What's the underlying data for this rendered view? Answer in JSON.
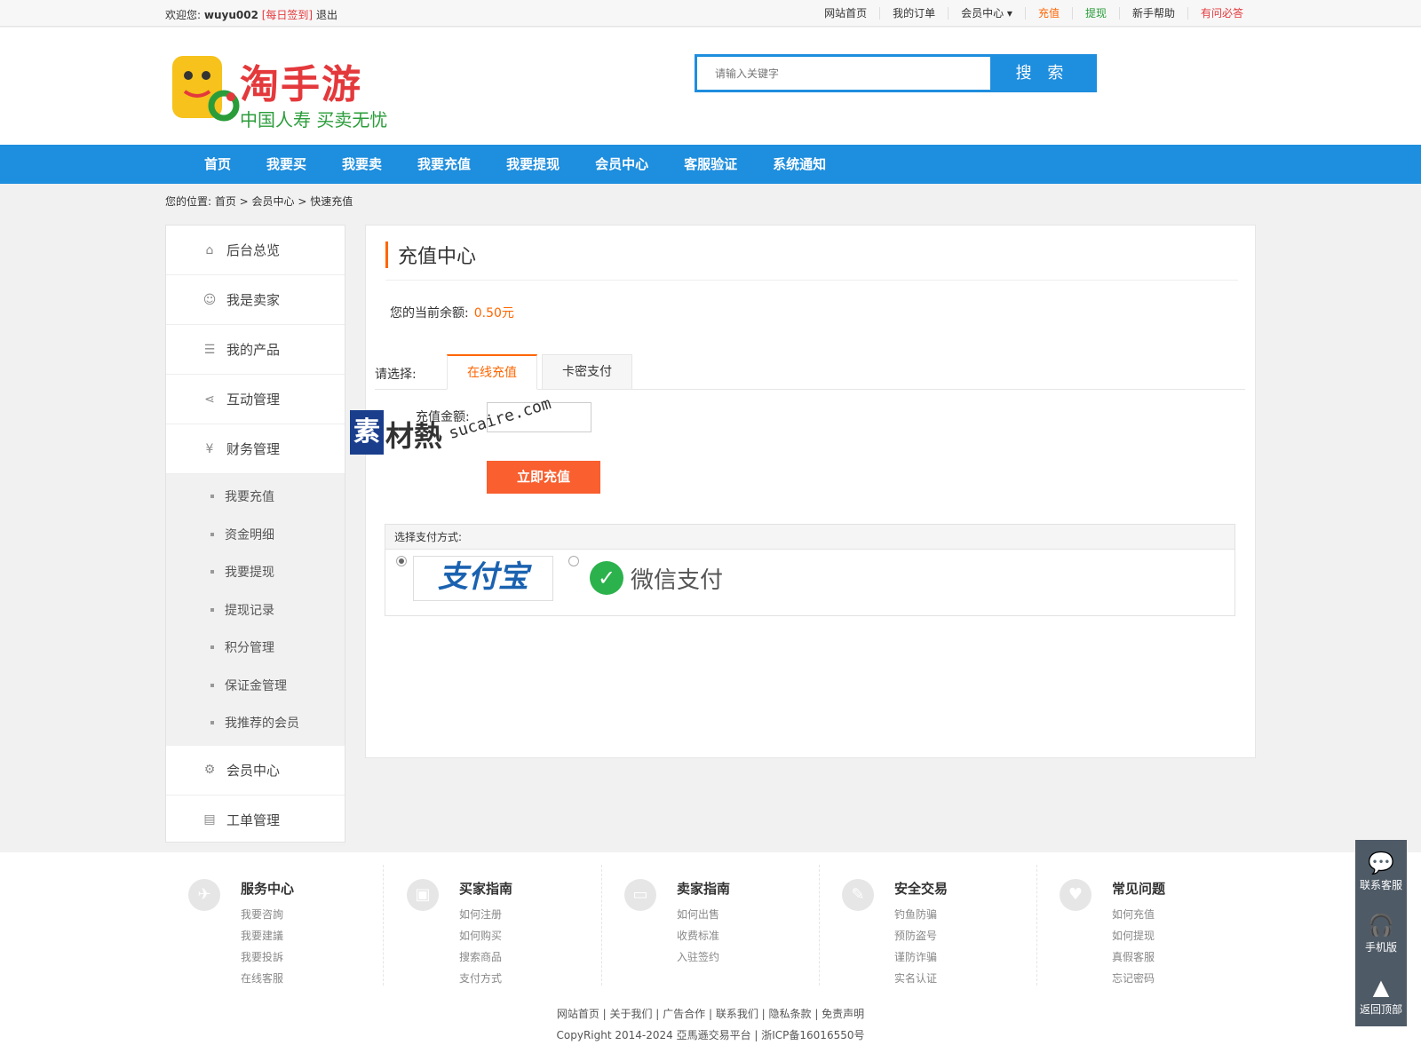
{
  "topbar": {
    "welcome": "欢迎您:",
    "username": "wuyu002",
    "sign": "[每日签到]",
    "logout": "退出",
    "links": [
      {
        "label": "网站首页",
        "style": ""
      },
      {
        "label": "我的订单",
        "style": ""
      },
      {
        "label": "会员中心 ▾",
        "style": ""
      },
      {
        "label": "充值",
        "style": "orange"
      },
      {
        "label": "提现",
        "style": "green"
      },
      {
        "label": "新手帮助",
        "style": ""
      },
      {
        "label": "有问必答",
        "style": "red"
      }
    ]
  },
  "header": {
    "logo_title": "淘手游",
    "logo_sub": "中国人寿 买卖无忧",
    "search_placeholder": "请输入关键字",
    "search_button": "搜 索"
  },
  "nav": [
    "首页",
    "我要买",
    "我要卖",
    "我要充值",
    "我要提现",
    "会员中心",
    "客服验证",
    "系统通知"
  ],
  "breadcrumb": "您的位置: 首页 > 会员中心 > 快速充值",
  "sidebar": {
    "items_top": [
      {
        "label": "后台总览",
        "icon": "home-icon",
        "glyph": "⌂"
      },
      {
        "label": "我是卖家",
        "icon": "user-icon",
        "glyph": "☺"
      },
      {
        "label": "我的产品",
        "icon": "list-icon",
        "glyph": "☰"
      },
      {
        "label": "互动管理",
        "icon": "share-icon",
        "glyph": "⋖"
      },
      {
        "label": "财务管理",
        "icon": "yen-icon",
        "glyph": "¥"
      }
    ],
    "sub_items": [
      "我要充值",
      "资金明细",
      "我要提现",
      "提现记录",
      "积分管理",
      "保证金管理",
      "我推荐的会员"
    ],
    "items_bottom": [
      {
        "label": "会员中心",
        "icon": "gear-icon",
        "glyph": "⚙"
      },
      {
        "label": "工单管理",
        "icon": "clipboard-icon",
        "glyph": "▤"
      }
    ]
  },
  "main": {
    "title": "充值中心",
    "balance_label": "您的当前余额:",
    "balance_value": "0.50元",
    "choose_label": "请选择:",
    "tab_online": "在线充值",
    "tab_card": "卡密支付",
    "amount_label": "充值金额:",
    "pay_button": "立即充值",
    "pay_method_label": "选择支付方式:",
    "alipay": "支付宝",
    "wechat": "微信支付"
  },
  "watermark": {
    "box": "素",
    "text": "材熱",
    "url": "sucaire.com"
  },
  "footer": {
    "columns": [
      {
        "title": "服务中心",
        "icon": "compass-icon",
        "glyph": "✈",
        "links": [
          "我要咨詢",
          "我要建議",
          "我要投訴",
          "在线客服"
        ]
      },
      {
        "title": "买家指南",
        "icon": "bus-icon",
        "glyph": "▣",
        "links": [
          "如何注册",
          "如何购买",
          "搜索商品",
          "支付方式"
        ]
      },
      {
        "title": "卖家指南",
        "icon": "wallet-icon",
        "glyph": "▭",
        "links": [
          "如何出售",
          "收费标准",
          "入驻签约"
        ]
      },
      {
        "title": "安全交易",
        "icon": "wrench-icon",
        "glyph": "✎",
        "links": [
          "钓鱼防骗",
          "预防盗号",
          "谨防诈骗",
          "实名认证"
        ]
      },
      {
        "title": "常见问题",
        "icon": "heart-icon",
        "glyph": "♥",
        "links": [
          "如何充值",
          "如何提现",
          "真假客服",
          "忘记密码"
        ]
      }
    ],
    "links": "网站首页 | 关于我们 | 广告合作 | 联系我们 | 隐私条款 | 免责声明",
    "copyright": "CopyRight 2014-2024 亞馬遜交易平台 | 浙ICP备16016550号"
  },
  "float": [
    {
      "label": "联系客服",
      "icon": "chat-icon",
      "glyph": "💬"
    },
    {
      "label": "手机版",
      "icon": "headset-icon",
      "glyph": "🎧"
    },
    {
      "label": "返回顶部",
      "icon": "rocket-icon",
      "glyph": "▲"
    }
  ]
}
